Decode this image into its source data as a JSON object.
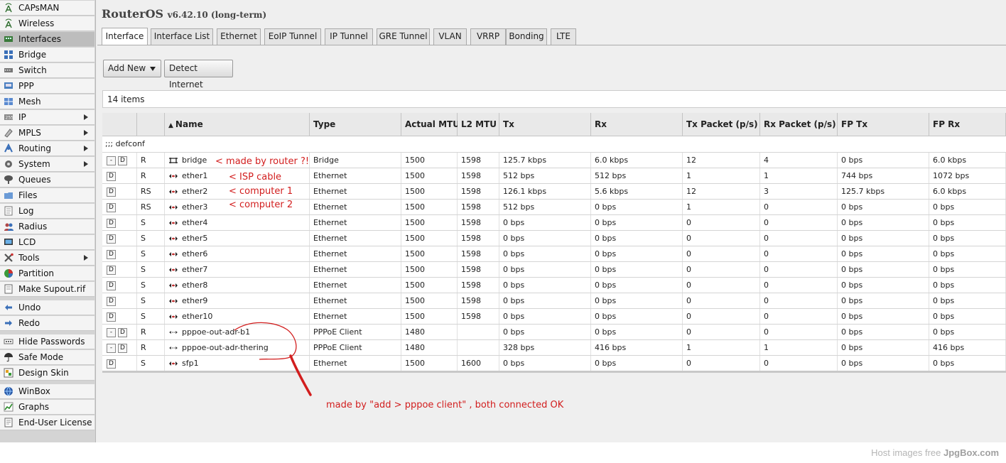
{
  "sidebar": {
    "items": [
      {
        "label": "CAPsMAN",
        "icon": "antenna-icon",
        "arrow": false,
        "active": false
      },
      {
        "label": "Wireless",
        "icon": "antenna-icon",
        "arrow": false,
        "active": false
      },
      {
        "label": "Interfaces",
        "icon": "interfaces-icon",
        "arrow": false,
        "active": true
      },
      {
        "label": "Bridge",
        "icon": "bridge-icon",
        "arrow": false,
        "active": false
      },
      {
        "label": "Switch",
        "icon": "switch-icon",
        "arrow": false,
        "active": false
      },
      {
        "label": "PPP",
        "icon": "ppp-icon",
        "arrow": false,
        "active": false
      },
      {
        "label": "Mesh",
        "icon": "mesh-icon",
        "arrow": false,
        "active": false
      },
      {
        "label": "IP",
        "icon": "ip-icon",
        "arrow": true,
        "active": false
      },
      {
        "label": "MPLS",
        "icon": "mpls-icon",
        "arrow": true,
        "active": false
      },
      {
        "label": "Routing",
        "icon": "routing-icon",
        "arrow": true,
        "active": false
      },
      {
        "label": "System",
        "icon": "gear-icon",
        "arrow": true,
        "active": false
      },
      {
        "label": "Queues",
        "icon": "queues-icon",
        "arrow": false,
        "active": false
      },
      {
        "label": "Files",
        "icon": "folder-icon",
        "arrow": false,
        "active": false
      },
      {
        "label": "Log",
        "icon": "log-icon",
        "arrow": false,
        "active": false
      },
      {
        "label": "Radius",
        "icon": "users-icon",
        "arrow": false,
        "active": false
      },
      {
        "label": "LCD",
        "icon": "lcd-icon",
        "arrow": false,
        "active": false
      },
      {
        "label": "Tools",
        "icon": "tools-icon",
        "arrow": true,
        "active": false
      },
      {
        "label": "Partition",
        "icon": "pie-icon",
        "arrow": false,
        "active": false
      },
      {
        "label": "Make Supout.rif",
        "icon": "document-icon",
        "arrow": false,
        "active": false
      },
      {
        "label": "Undo",
        "icon": "undo-icon",
        "arrow": false,
        "active": false
      },
      {
        "label": "Redo",
        "icon": "redo-icon",
        "arrow": false,
        "active": false
      },
      {
        "label": "Hide Passwords",
        "icon": "password-icon",
        "arrow": false,
        "active": false
      },
      {
        "label": "Safe Mode",
        "icon": "umbrella-icon",
        "arrow": false,
        "active": false
      },
      {
        "label": "Design Skin",
        "icon": "skin-icon",
        "arrow": false,
        "active": false
      },
      {
        "label": "WinBox",
        "icon": "globe-icon",
        "arrow": false,
        "active": false
      },
      {
        "label": "Graphs",
        "icon": "graph-icon",
        "arrow": false,
        "active": false
      },
      {
        "label": "End-User License",
        "icon": "license-icon",
        "arrow": false,
        "active": false
      }
    ]
  },
  "header": {
    "title": "RouterOS",
    "version": "v6.42.10 (long-term)"
  },
  "tabs": [
    "Interface",
    "Interface List",
    "Ethernet",
    "EoIP Tunnel",
    "IP Tunnel",
    "GRE Tunnel",
    "VLAN",
    "VRRP",
    "Bonding",
    "LTE"
  ],
  "toolbar": {
    "add_new": "Add New",
    "detect_internet": "Detect Internet"
  },
  "table": {
    "count": "14 items",
    "sort_arrow": "▲",
    "columns": [
      "",
      "",
      "Name",
      "Type",
      "Actual MTU",
      "L2 MTU",
      "Tx",
      "Rx",
      "Tx Packet (p/s)",
      "Rx Packet (p/s)",
      "FP Tx",
      "FP Rx"
    ],
    "comment": ";;; defconf",
    "rows": [
      {
        "btns": [
          "-",
          "D"
        ],
        "flags": "R",
        "icon": "bridge",
        "name": "bridge",
        "type": "Bridge",
        "mtu": "1500",
        "l2mtu": "1598",
        "tx": "125.7 kbps",
        "rx": "6.0 kbps",
        "txp": "12",
        "rxp": "4",
        "fptx": "0 bps",
        "fprx": "6.0 kbps"
      },
      {
        "btns": [
          "D"
        ],
        "flags": "R",
        "icon": "eth",
        "name": "ether1",
        "type": "Ethernet",
        "mtu": "1500",
        "l2mtu": "1598",
        "tx": "512 bps",
        "rx": "512 bps",
        "txp": "1",
        "rxp": "1",
        "fptx": "744 bps",
        "fprx": "1072 bps"
      },
      {
        "btns": [
          "D"
        ],
        "flags": "RS",
        "icon": "eth",
        "name": "ether2",
        "type": "Ethernet",
        "mtu": "1500",
        "l2mtu": "1598",
        "tx": "126.1 kbps",
        "rx": "5.6 kbps",
        "txp": "12",
        "rxp": "3",
        "fptx": "125.7 kbps",
        "fprx": "6.0 kbps"
      },
      {
        "btns": [
          "D"
        ],
        "flags": "RS",
        "icon": "eth",
        "name": "ether3",
        "type": "Ethernet",
        "mtu": "1500",
        "l2mtu": "1598",
        "tx": "512 bps",
        "rx": "0 bps",
        "txp": "1",
        "rxp": "0",
        "fptx": "0 bps",
        "fprx": "0 bps"
      },
      {
        "btns": [
          "D"
        ],
        "flags": "S",
        "icon": "eth",
        "name": "ether4",
        "type": "Ethernet",
        "mtu": "1500",
        "l2mtu": "1598",
        "tx": "0 bps",
        "rx": "0 bps",
        "txp": "0",
        "rxp": "0",
        "fptx": "0 bps",
        "fprx": "0 bps"
      },
      {
        "btns": [
          "D"
        ],
        "flags": "S",
        "icon": "eth",
        "name": "ether5",
        "type": "Ethernet",
        "mtu": "1500",
        "l2mtu": "1598",
        "tx": "0 bps",
        "rx": "0 bps",
        "txp": "0",
        "rxp": "0",
        "fptx": "0 bps",
        "fprx": "0 bps"
      },
      {
        "btns": [
          "D"
        ],
        "flags": "S",
        "icon": "eth",
        "name": "ether6",
        "type": "Ethernet",
        "mtu": "1500",
        "l2mtu": "1598",
        "tx": "0 bps",
        "rx": "0 bps",
        "txp": "0",
        "rxp": "0",
        "fptx": "0 bps",
        "fprx": "0 bps"
      },
      {
        "btns": [
          "D"
        ],
        "flags": "S",
        "icon": "eth",
        "name": "ether7",
        "type": "Ethernet",
        "mtu": "1500",
        "l2mtu": "1598",
        "tx": "0 bps",
        "rx": "0 bps",
        "txp": "0",
        "rxp": "0",
        "fptx": "0 bps",
        "fprx": "0 bps"
      },
      {
        "btns": [
          "D"
        ],
        "flags": "S",
        "icon": "eth",
        "name": "ether8",
        "type": "Ethernet",
        "mtu": "1500",
        "l2mtu": "1598",
        "tx": "0 bps",
        "rx": "0 bps",
        "txp": "0",
        "rxp": "0",
        "fptx": "0 bps",
        "fprx": "0 bps"
      },
      {
        "btns": [
          "D"
        ],
        "flags": "S",
        "icon": "eth",
        "name": "ether9",
        "type": "Ethernet",
        "mtu": "1500",
        "l2mtu": "1598",
        "tx": "0 bps",
        "rx": "0 bps",
        "txp": "0",
        "rxp": "0",
        "fptx": "0 bps",
        "fprx": "0 bps"
      },
      {
        "btns": [
          "D"
        ],
        "flags": "S",
        "icon": "eth",
        "name": "ether10",
        "type": "Ethernet",
        "mtu": "1500",
        "l2mtu": "1598",
        "tx": "0 bps",
        "rx": "0 bps",
        "txp": "0",
        "rxp": "0",
        "fptx": "0 bps",
        "fprx": "0 bps"
      },
      {
        "btns": [
          "-",
          "D"
        ],
        "flags": "R",
        "icon": "pppoe",
        "name": "pppoe-out-adr-b1",
        "type": "PPPoE Client",
        "mtu": "1480",
        "l2mtu": "",
        "tx": "0 bps",
        "rx": "0 bps",
        "txp": "0",
        "rxp": "0",
        "fptx": "0 bps",
        "fprx": "0 bps"
      },
      {
        "btns": [
          "-",
          "D"
        ],
        "flags": "R",
        "icon": "pppoe",
        "name": "pppoe-out-adr-thering",
        "type": "PPPoE Client",
        "mtu": "1480",
        "l2mtu": "",
        "tx": "328 bps",
        "rx": "416 bps",
        "txp": "1",
        "rxp": "1",
        "fptx": "0 bps",
        "fprx": "416 bps"
      },
      {
        "btns": [
          "D"
        ],
        "flags": "S",
        "icon": "eth",
        "name": "sfp1",
        "type": "Ethernet",
        "mtu": "1500",
        "l2mtu": "1600",
        "tx": "0 bps",
        "rx": "0 bps",
        "txp": "0",
        "rxp": "0",
        "fptx": "0 bps",
        "fprx": "0 bps"
      }
    ]
  },
  "annotations": {
    "bridge_note": "< made by router ?!",
    "isp_note": "< ISP cable",
    "pc1_note": "< computer 1",
    "pc2_note": "< computer 2",
    "pppoe_note": "made by \"add > pppoe client\" , both connected OK",
    "color": "#d21e1e"
  },
  "footer": {
    "prefix": "Host images free ",
    "brand": "JpgBox.com"
  },
  "colors": {
    "accent_red": "#d21e1e",
    "sidebar_bg": "#f4f4f4",
    "active_bg": "#bdbdbd"
  }
}
